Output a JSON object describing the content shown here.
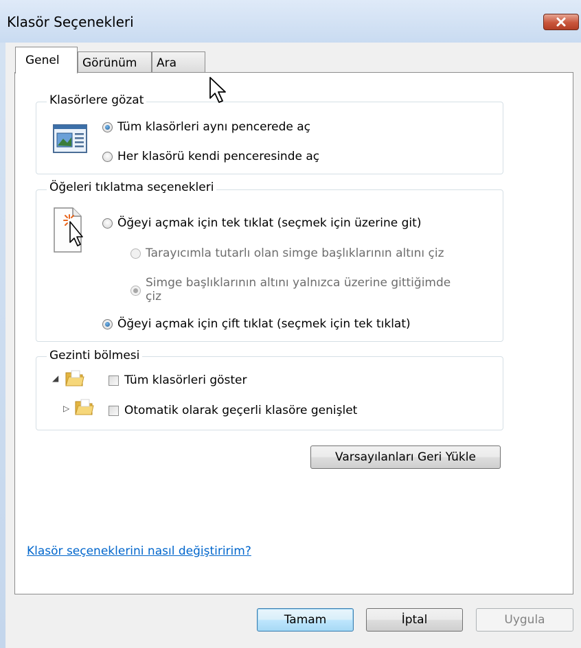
{
  "window": {
    "title": "Klasör Seçenekleri"
  },
  "tabs": [
    {
      "label": "Genel",
      "active": true
    },
    {
      "label": "Görünüm",
      "active": false
    },
    {
      "label": "Ara",
      "active": false
    }
  ],
  "browse_group": {
    "label": "Klasörlere gözat",
    "options": [
      {
        "label": "Tüm klasörleri aynı pencerede aç",
        "checked": true
      },
      {
        "label": "Her klasörü kendi penceresinde aç",
        "checked": false
      }
    ]
  },
  "click_group": {
    "label": "Öğeleri tıklatma seçenekleri",
    "single_click": {
      "label": "Öğeyi açmak için tek tıklat (seçmek için üzerine git)",
      "checked": false
    },
    "underline_browser": {
      "label": "Tarayıcımla tutarlı olan simge başlıklarının altını çiz",
      "checked": false,
      "enabled": false
    },
    "underline_hover": {
      "label_line1": "Simge başlıklarının altını yalnızca üzerine gittiğimde",
      "label_line2": "çiz",
      "checked": true,
      "enabled": false
    },
    "double_click": {
      "label": "Öğeyi açmak için çift tıklat (seçmek için tek tıklat)",
      "checked": true
    }
  },
  "nav_group": {
    "label": "Gezinti bölmesi",
    "show_all": {
      "label": "Tüm klasörleri göster",
      "checked": false
    },
    "auto_expand": {
      "label": "Otomatik olarak geçerli klasöre genişlet",
      "checked": false
    }
  },
  "restore_button": {
    "label": "Varsayılanları Geri Yükle"
  },
  "help_link": {
    "label": "Klasör seçeneklerini nasıl değiştiririm?"
  },
  "footer": {
    "ok": "Tamam",
    "cancel": "İptal",
    "apply": "Uygula",
    "apply_enabled": false
  },
  "colors": {
    "link": "#0066cc",
    "radio_checked": "#1d5c98",
    "close_button": "#c9563c"
  },
  "icons": {
    "browse_group": "window-layout-icon",
    "click_group": "document-click-icon",
    "tree_expanded": "triangle-down-icon",
    "tree_collapsed": "triangle-right-icon",
    "folder": "folder-icon",
    "cursor": "mouse-pointer-icon"
  }
}
